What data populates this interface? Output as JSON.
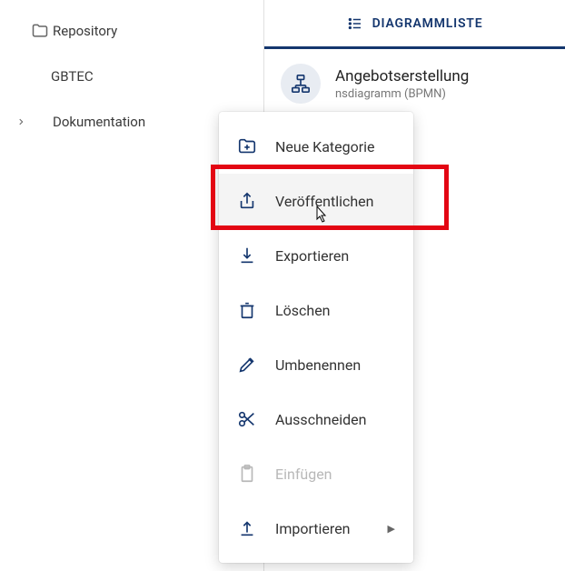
{
  "sidebar": {
    "items": [
      {
        "label": "Repository",
        "hasIcon": true
      },
      {
        "label": "GBTEC"
      },
      {
        "label": "Dokumentation",
        "hasChevron": true
      }
    ]
  },
  "tab": {
    "label": "DIAGRAMMLISTE"
  },
  "diagram": {
    "title": "Angebotserstellung",
    "subtitle": "nsdiagramm (BPMN)"
  },
  "menu": {
    "items": [
      {
        "label": "Neue Kategorie"
      },
      {
        "label": "Veröffentlichen"
      },
      {
        "label": "Exportieren"
      },
      {
        "label": "Löschen"
      },
      {
        "label": "Umbenennen"
      },
      {
        "label": "Ausschneiden"
      },
      {
        "label": "Einfügen"
      },
      {
        "label": "Importieren"
      }
    ]
  }
}
